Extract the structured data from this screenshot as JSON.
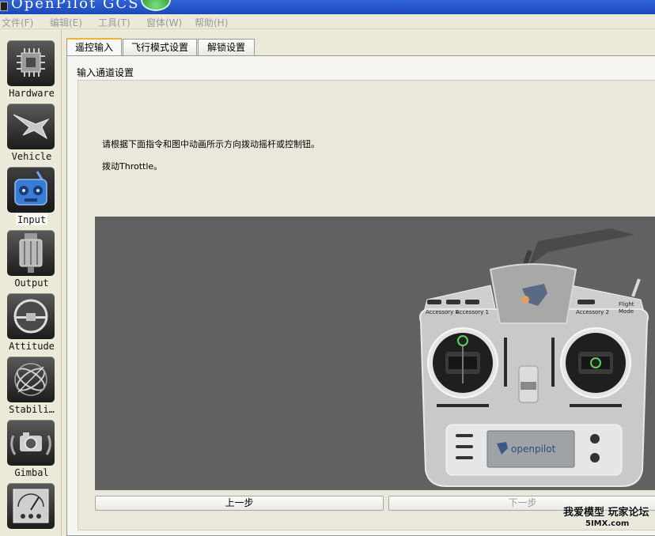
{
  "window": {
    "title": "OpenPilot GCS"
  },
  "menu": [
    "文件(F)",
    "编辑(E)",
    "工具(T)",
    "窗体(W)",
    "帮助(H)"
  ],
  "sidebar": {
    "items": [
      {
        "label": "Hardware",
        "icon": "chip-icon"
      },
      {
        "label": "Vehicle",
        "icon": "aircraft-icon"
      },
      {
        "label": "Input",
        "icon": "transmitter-icon",
        "active": true
      },
      {
        "label": "Output",
        "icon": "motor-icon"
      },
      {
        "label": "Attitude",
        "icon": "horizon-icon"
      },
      {
        "label": "Stabili…",
        "icon": "gyro-icon"
      },
      {
        "label": "Gimbal",
        "icon": "camera-icon"
      },
      {
        "label": "",
        "icon": "gauge-icon"
      }
    ]
  },
  "tabs": [
    "遥控输入",
    "飞行模式设置",
    "解锁设置"
  ],
  "group": {
    "title": "输入通道设置"
  },
  "instructions": {
    "line1": "请根据下面指令和图中动画所示方向拨动摇杆或控制钮。",
    "line2": "拨动Throttle。"
  },
  "transmitter": {
    "labels": [
      "Accessory 0",
      "Accessory 1",
      "Accessory 2",
      "Flight",
      "Mode"
    ],
    "brand": "openpilot"
  },
  "nav": {
    "prev": "上一步",
    "next": "下一步"
  },
  "watermark": {
    "line1": "我爱模型 玩家论坛",
    "line2": "5IMX.com"
  },
  "colors": {
    "stage_bg": "#616161",
    "tab_accent": "#f4b13a",
    "input_icon_blue": "#3a7bd5"
  }
}
